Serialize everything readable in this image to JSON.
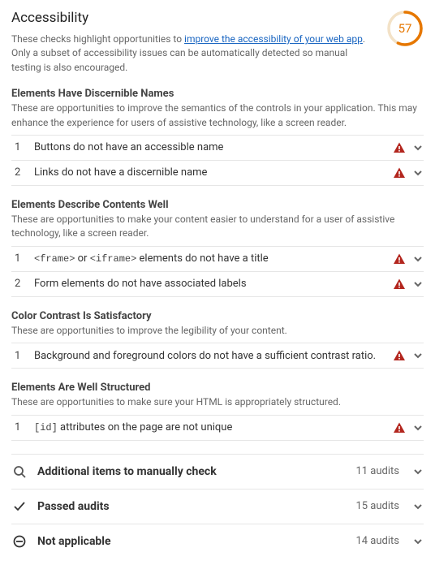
{
  "header": {
    "title": "Accessibility",
    "desc_pre": "These checks highlight opportunities to ",
    "desc_link": "improve the accessibility of your web app",
    "desc_post": ". Only a subset of accessibility issues can be automatically detected so manual testing is also encouraged.",
    "score": "57"
  },
  "sections": [
    {
      "title": "Elements Have Discernible Names",
      "desc": "These are opportunities to improve the semantics of the controls in your application. This may enhance the experience for users of assistive technology, like a screen reader.",
      "items": [
        {
          "num": "1",
          "text": "Buttons do not have an accessible name"
        },
        {
          "num": "2",
          "text": "Links do not have a discernible name"
        }
      ]
    },
    {
      "title": "Elements Describe Contents Well",
      "desc": "These are opportunities to make your content easier to understand for a user of assistive technology, like a screen reader.",
      "items": [
        {
          "num": "1",
          "html": "<span class=\"code\">&lt;frame&gt;</span> or <span class=\"code\">&lt;iframe&gt;</span> elements do not have a title"
        },
        {
          "num": "2",
          "text": "Form elements do not have associated labels"
        }
      ]
    },
    {
      "title": "Color Contrast Is Satisfactory",
      "desc": "These are opportunities to improve the legibility of your content.",
      "items": [
        {
          "num": "1",
          "text": "Background and foreground colors do not have a sufficient contrast ratio."
        }
      ]
    },
    {
      "title": "Elements Are Well Structured",
      "desc": "These are opportunities to make sure your HTML is appropriately structured.",
      "items": [
        {
          "num": "1",
          "html": "<span class=\"code\">[id]</span> attributes on the page are not unique"
        }
      ]
    }
  ],
  "summaries": [
    {
      "icon": "search",
      "label": "Additional items to manually check",
      "count": "11 audits"
    },
    {
      "icon": "check",
      "label": "Passed audits",
      "count": "15 audits"
    },
    {
      "icon": "na",
      "label": "Not applicable",
      "count": "14 audits"
    }
  ]
}
